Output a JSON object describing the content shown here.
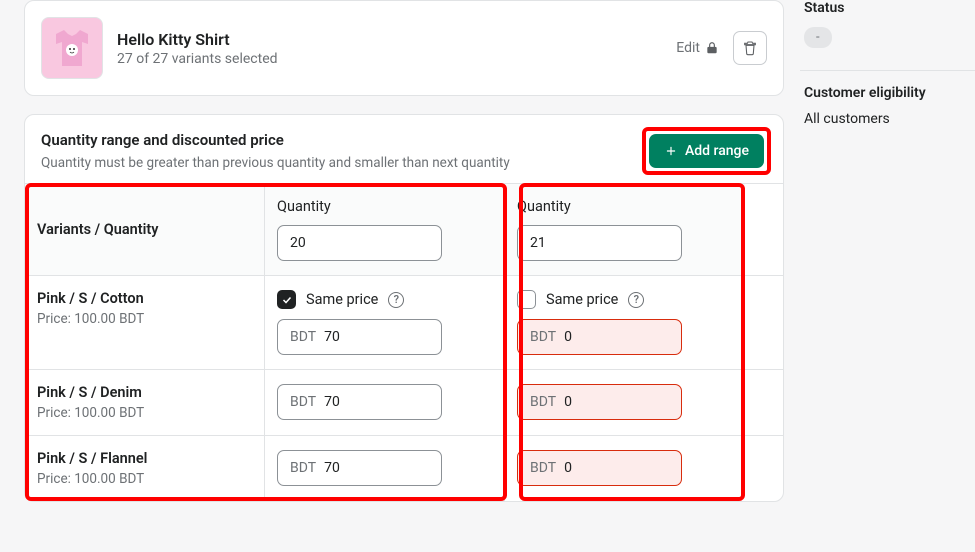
{
  "product": {
    "title": "Hello Kitty Shirt",
    "subtitle": "27 of 27 variants selected",
    "edit_label": "Edit"
  },
  "pricing": {
    "heading": "Quantity range and discounted price",
    "subheading": "Quantity must be greater than previous quantity and smaller than next quantity",
    "add_range_label": "Add range",
    "variants_header": "Variants / Quantity",
    "quantity_label": "Quantity",
    "same_price_label": "Same price",
    "currency_prefix": "BDT",
    "price_prefix": "Price: ",
    "ranges": [
      {
        "quantity": "20",
        "same_price_checked": true
      },
      {
        "quantity": "21",
        "same_price_checked": false
      }
    ],
    "variants": [
      {
        "name": "Pink / S / Cotton",
        "price": "100.00 BDT",
        "values": [
          "70",
          "0"
        ]
      },
      {
        "name": "Pink / S / Denim",
        "price": "100.00 BDT",
        "values": [
          "70",
          "0"
        ]
      },
      {
        "name": "Pink / S / Flannel",
        "price": "100.00 BDT",
        "values": [
          "70",
          "0"
        ]
      }
    ]
  },
  "sidebar": {
    "status_heading": "Status",
    "status_value": "-",
    "eligibility_heading": "Customer eligibility",
    "eligibility_value": "All customers"
  }
}
